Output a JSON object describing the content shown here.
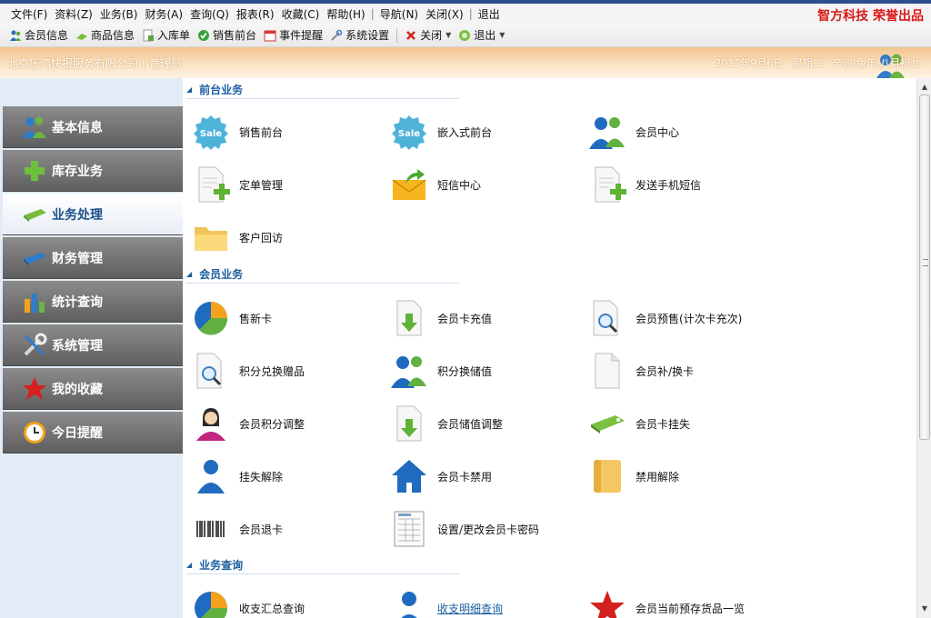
{
  "menu": [
    "文件(F)",
    "资料(Z)",
    "业务(B)",
    "财务(A)",
    "查询(Q)",
    "报表(R)",
    "收藏(C)",
    "帮助(H)",
    "导航(N)",
    "关闭(X)",
    "退出"
  ],
  "brand": "智方科技 荣誉出品",
  "toolbar": {
    "items": [
      "会员信息",
      "商品信息",
      "入库单",
      "销售前台",
      "事件提醒",
      "系统设置"
    ],
    "close_label": "关闭",
    "exit_label": "退出"
  },
  "banner": {
    "company": "北京乐鸿快报服务有限公司",
    "role": "管理员",
    "date": "2011年9月6日",
    "weekday": "星期二",
    "lunar": "辛卯(兔年)八月初九"
  },
  "sidebar": {
    "items": [
      "基本信息",
      "库存业务",
      "业务处理",
      "财务管理",
      "统计查询",
      "系统管理",
      "我的收藏",
      "今日提醒"
    ],
    "active": "业务处理"
  },
  "sections": [
    {
      "title": "前台业务",
      "items": [
        {
          "label": "销售前台",
          "icon": "sale-badge-icon"
        },
        {
          "label": "嵌入式前台",
          "icon": "sale-badge-icon"
        },
        {
          "label": "会员中心",
          "icon": "users-icon"
        },
        {
          "label": "定单管理",
          "icon": "document-add-icon"
        },
        {
          "label": "短信中心",
          "icon": "mail-arrow-icon"
        },
        {
          "label": "发送手机短信",
          "icon": "document-add-icon"
        },
        {
          "label": "客户回访",
          "icon": "folder-icon"
        }
      ]
    },
    {
      "title": "会员业务",
      "items": [
        {
          "label": "售新卡",
          "icon": "pie-chart-icon"
        },
        {
          "label": "会员卡充值",
          "icon": "document-download-icon"
        },
        {
          "label": "会员预售(计次卡充次)",
          "icon": "document-search-icon"
        },
        {
          "label": "积分兑换赠品",
          "icon": "document-search-icon"
        },
        {
          "label": "积分换储值",
          "icon": "users-icon"
        },
        {
          "label": "会员补/换卡",
          "icon": "document-blank-icon"
        },
        {
          "label": "会员积分调整",
          "icon": "user-female-icon"
        },
        {
          "label": "会员储值调整",
          "icon": "document-download-icon"
        },
        {
          "label": "会员卡挂失",
          "icon": "tag-icon"
        },
        {
          "label": "挂失解除",
          "icon": "user-icon"
        },
        {
          "label": "会员卡禁用",
          "icon": "home-icon"
        },
        {
          "label": "禁用解除",
          "icon": "notebook-icon"
        },
        {
          "label": "会员退卡",
          "icon": "barcode-icon"
        },
        {
          "label": "设置/更改会员卡密码",
          "icon": "spreadsheet-icon"
        }
      ]
    },
    {
      "title": "业务查询",
      "items": [
        {
          "label": "收支汇总查询",
          "icon": "pie-chart-icon"
        },
        {
          "label": "收支明细查询",
          "icon": "user-icon"
        },
        {
          "label": "会员当前预存货品一览",
          "icon": "star-icon"
        }
      ]
    }
  ],
  "colors": {
    "accent": "#1a5fa0",
    "brand": "#d81818",
    "sidebar_bg": "#e1ecf7",
    "banner": "#f3c48e"
  }
}
